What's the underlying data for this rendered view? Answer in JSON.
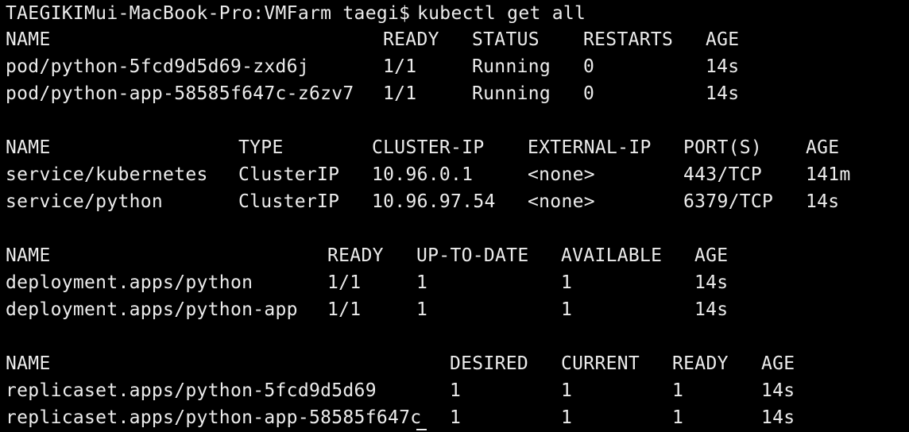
{
  "prompt": {
    "host": "TAEGIKIMui-MacBook-Pro:VMFarm taegi$",
    "command": "kubectl get all"
  },
  "pods": {
    "headers": [
      "NAME",
      "READY",
      "STATUS",
      "RESTARTS",
      "AGE"
    ],
    "rows": [
      [
        "pod/python-5fcd9d5d69-zxd6j",
        "1/1",
        "Running",
        "0",
        "14s"
      ],
      [
        "pod/python-app-58585f647c-z6zv7",
        "1/1",
        "Running",
        "0",
        "14s"
      ]
    ]
  },
  "services": {
    "headers": [
      "NAME",
      "TYPE",
      "CLUSTER-IP",
      "EXTERNAL-IP",
      "PORT(S)",
      "AGE"
    ],
    "rows": [
      [
        "service/kubernetes",
        "ClusterIP",
        "10.96.0.1",
        "<none>",
        "443/TCP",
        "141m"
      ],
      [
        "service/python",
        "ClusterIP",
        "10.96.97.54",
        "<none>",
        "6379/TCP",
        "14s"
      ]
    ]
  },
  "deployments": {
    "headers": [
      "NAME",
      "READY",
      "UP-TO-DATE",
      "AVAILABLE",
      "AGE"
    ],
    "rows": [
      [
        "deployment.apps/python",
        "1/1",
        "1",
        "1",
        "14s"
      ],
      [
        "deployment.apps/python-app",
        "1/1",
        "1",
        "1",
        "14s"
      ]
    ]
  },
  "replicasets": {
    "headers": [
      "NAME",
      "DESIRED",
      "CURRENT",
      "READY",
      "AGE"
    ],
    "rows": [
      [
        "replicaset.apps/python-5fcd9d5d69",
        "1",
        "1",
        "1",
        "14s"
      ],
      [
        "replicaset.apps/python-app-58585f647c",
        "1",
        "1",
        "1",
        "14s"
      ]
    ]
  },
  "colors": {
    "background": "#000000",
    "foreground": "#ececec"
  }
}
